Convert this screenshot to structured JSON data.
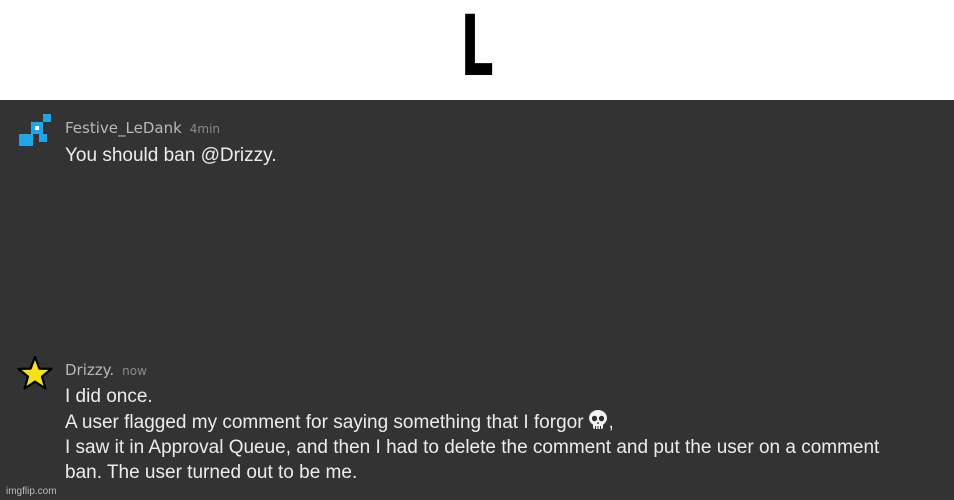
{
  "caption": {
    "text": "L"
  },
  "comments": [
    {
      "username": "Festive_LeDank",
      "timestamp": "4min",
      "avatar_icon": "blue-pixel-avatar-icon",
      "lines": [
        "You should ban @Drizzy."
      ]
    },
    {
      "username": "Drizzy.",
      "timestamp": "now",
      "avatar_icon": "star-avatar-icon",
      "lines": [
        "I did once.",
        "A user flagged my comment for saying something that I forgor",
        ",",
        "I saw it in Approval Queue, and then I had to delete the comment and put the user on a comment",
        "ban. The user turned out to be me."
      ],
      "emoji_icon": "skull-emoji-icon"
    }
  ],
  "watermark": "imgflip.com",
  "colors": {
    "chat_background": "#333333",
    "username": "#b8b8b8",
    "timestamp": "#8a8a8a",
    "body_text": "#ececec",
    "accent_blue": "#1fa6e8",
    "star_yellow": "#f5e11a"
  }
}
